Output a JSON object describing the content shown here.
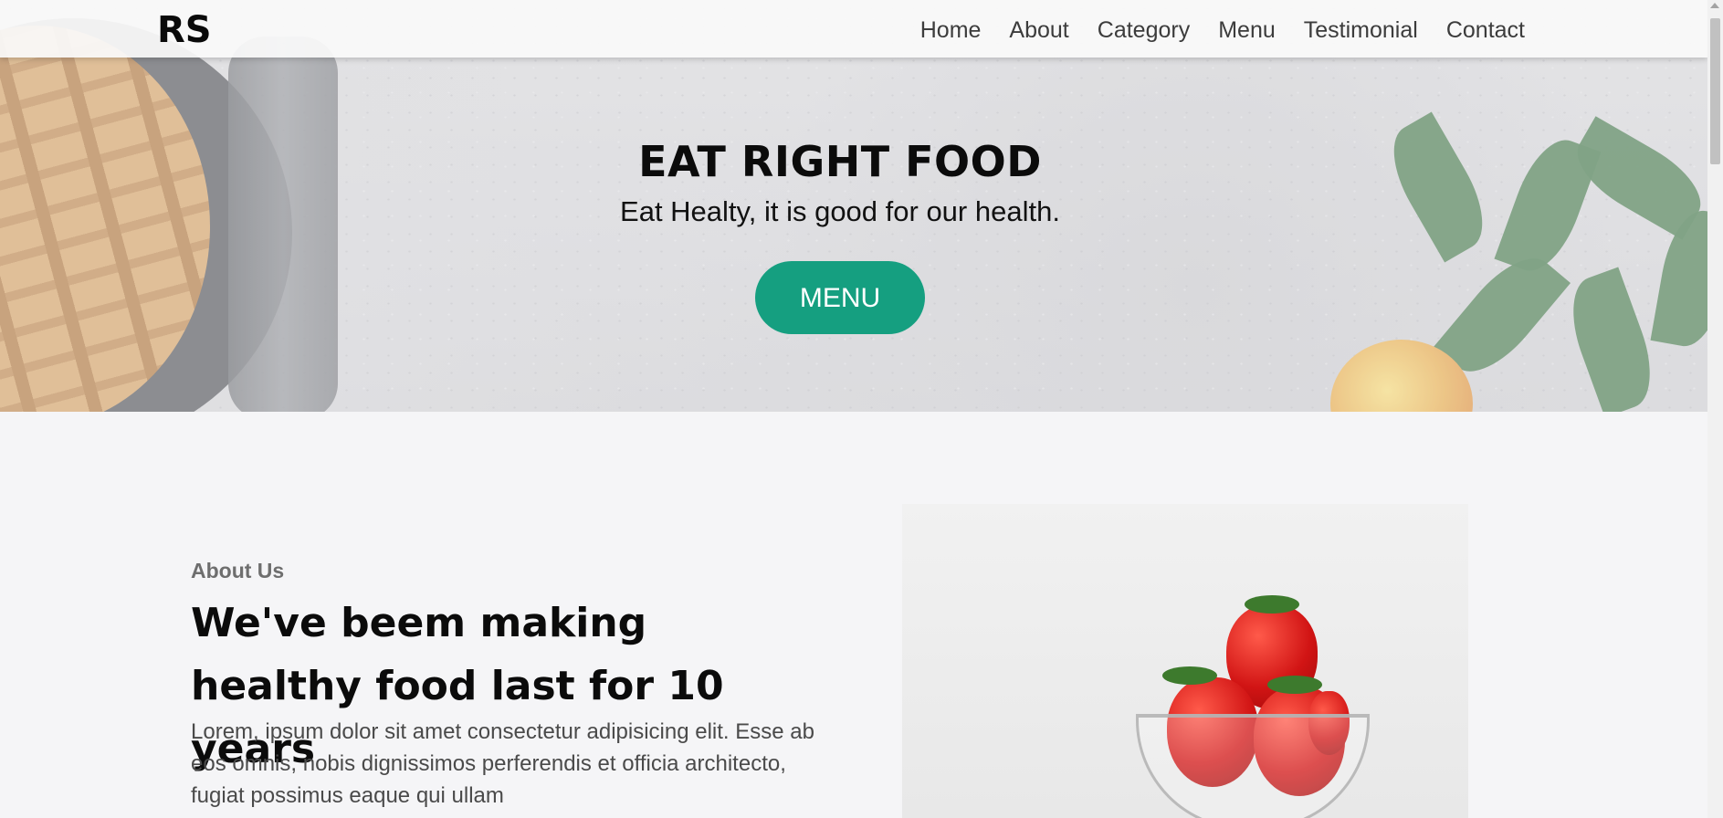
{
  "brand": {
    "logo": "RS"
  },
  "nav": {
    "items": [
      {
        "label": "Home"
      },
      {
        "label": "About"
      },
      {
        "label": "Category"
      },
      {
        "label": "Menu"
      },
      {
        "label": "Testimonial"
      },
      {
        "label": "Contact"
      }
    ]
  },
  "hero": {
    "title": "EAT RIGHT FOOD",
    "subtitle": "Eat Healty, it is good for our health.",
    "button_label": "MENU"
  },
  "about": {
    "kicker": "About Us",
    "title": "We've beem making healthy food last for 10 years",
    "body": "Lorem, ipsum dolor sit amet consectetur adipisicing elit. Esse ab eos omnis, nobis dignissimos perferendis et officia architecto, fugiat possimus eaque qui ullam"
  },
  "colors": {
    "accent": "#159f80",
    "background": "#f5f5f7",
    "text_dark": "#0b0b0b"
  },
  "icons": {
    "scroll_up": "scroll-up-arrow-icon"
  }
}
